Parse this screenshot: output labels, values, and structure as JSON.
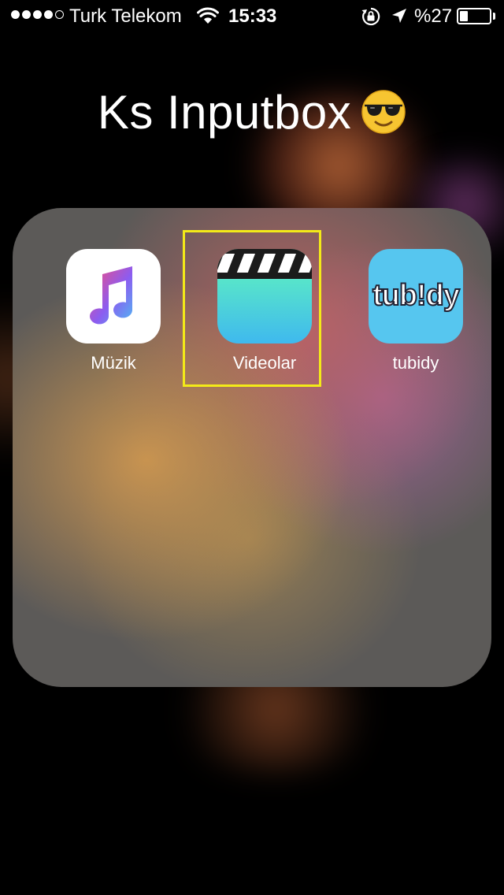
{
  "status_bar": {
    "carrier": "Turk Telekom",
    "time": "15:33",
    "battery_text": "%27",
    "battery_level": 0.27,
    "signal_bars_filled": 4,
    "signal_bars_total": 5,
    "icons": [
      "signal-dots-icon",
      "wifi-icon",
      "rotation-lock-icon",
      "location-arrow-icon",
      "battery-icon"
    ]
  },
  "folder": {
    "title": "Ks Inputbox",
    "title_emoji_icon": "sunglasses-face-emoji",
    "apps": [
      {
        "label": "Müzik",
        "icon": "music-note-icon"
      },
      {
        "label": "Videolar",
        "icon": "clapperboard-icon"
      },
      {
        "label": "tubidy",
        "icon": "tubidy-logo-icon",
        "logo_text": "tub!dy"
      }
    ]
  },
  "highlight": {
    "target": "Videolar",
    "color": "#f3ea18"
  },
  "colors": {
    "music_pink": "#f94b7a",
    "music_purple": "#8c5cf0",
    "music_blue": "#4fb6f3",
    "videolar_top": "#5ae9c7",
    "videolar_bottom": "#3fb9ee",
    "tubidy_bg": "#56c6ef"
  }
}
